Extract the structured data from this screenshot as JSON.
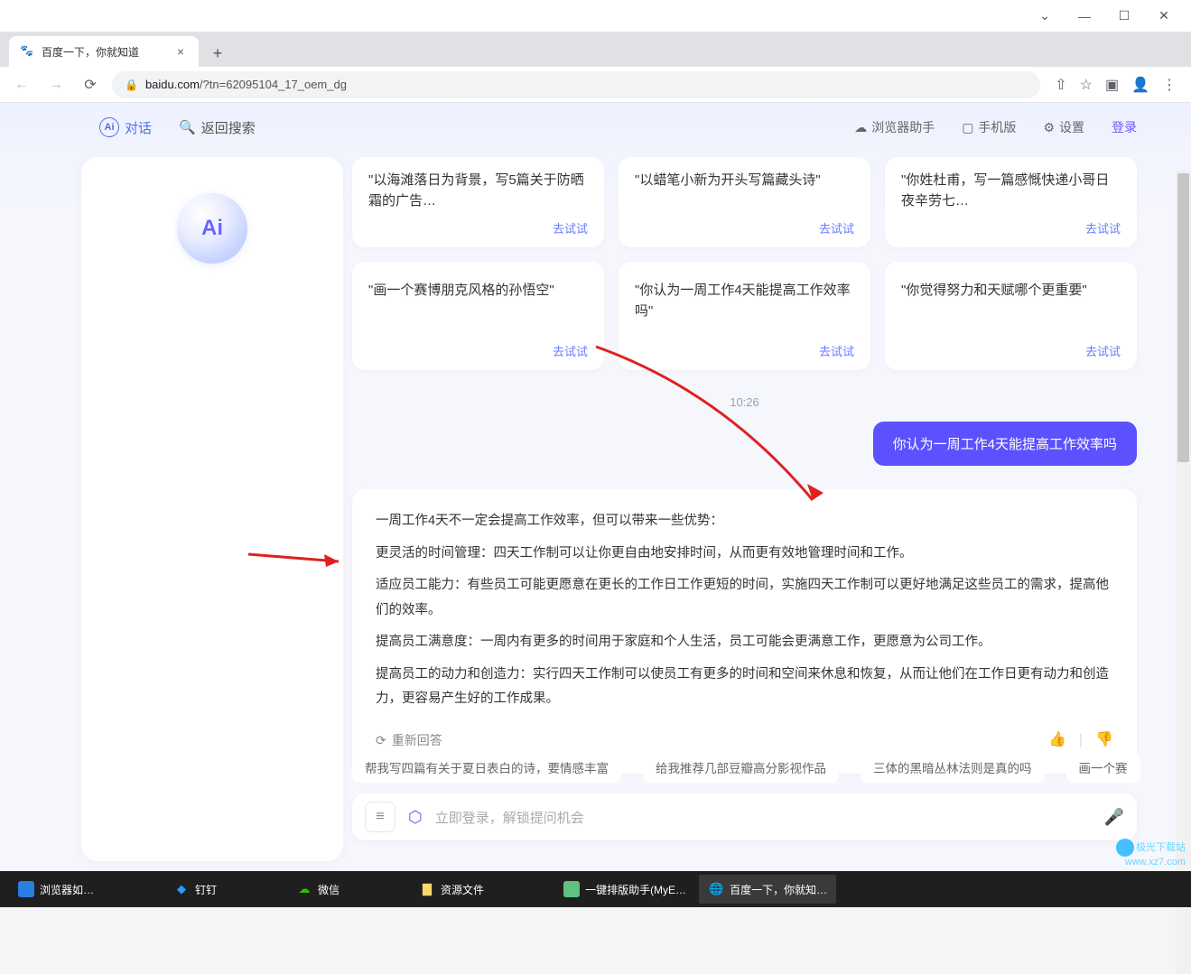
{
  "browser": {
    "tab_title": "百度一下，你就知道",
    "url_display": "baidu.com/?tn=62095104_17_oem_dg",
    "url_domain": "baidu.com",
    "url_path": "/?tn=62095104_17_oem_dg"
  },
  "topnav": {
    "dialog": "对话",
    "back_search": "返回搜索",
    "browser_helper": "浏览器助手",
    "mobile": "手机版",
    "settings": "设置",
    "login": "登录"
  },
  "sidebar": {
    "logo_text": "Ai"
  },
  "cards_row1": [
    {
      "text": "\"以海滩落日为背景，写5篇关于防晒霜的广告…",
      "action": "去试试"
    },
    {
      "text": "\"以蜡笔小新为开头写篇藏头诗\"",
      "action": "去试试"
    },
    {
      "text": "\"你姓杜甫，写一篇感慨快递小哥日夜辛劳七…",
      "action": "去试试"
    }
  ],
  "cards_row2": [
    {
      "text": "\"画一个赛博朋克风格的孙悟空\"",
      "action": "去试试"
    },
    {
      "text": "\"你认为一周工作4天能提高工作效率吗\"",
      "action": "去试试"
    },
    {
      "text": "\"你觉得努力和天赋哪个更重要\"",
      "action": "去试试"
    }
  ],
  "chat": {
    "time": "10:26",
    "user_message": "你认为一周工作4天能提高工作效率吗",
    "answer": {
      "p1": "一周工作4天不一定会提高工作效率，但可以带来一些优势：",
      "p2": "更灵活的时间管理：四天工作制可以让你更自由地安排时间，从而更有效地管理时间和工作。",
      "p3": "适应员工能力：有些员工可能更愿意在更长的工作日工作更短的时间，实施四天工作制可以更好地满足这些员工的需求，提高他们的效率。",
      "p4": "提高员工满意度：一周内有更多的时间用于家庭和个人生活，员工可能会更满意工作，更愿意为公司工作。",
      "p5": "提高员工的动力和创造力：实行四天工作制可以使员工有更多的时间和空间来休息和恢复，从而让他们在工作日更有动力和创造力，更容易产生好的工作成果。"
    },
    "regenerate": "重新回答"
  },
  "suggestions": [
    "帮我写四篇有关于夏日表白的诗，要情感丰富",
    "给我推荐几部豆瓣高分影视作品",
    "三体的黑暗丛林法则是真的吗",
    "画一个赛"
  ],
  "input": {
    "placeholder": "立即登录，解锁提问机会"
  },
  "taskbar": {
    "items": [
      {
        "label": "浏览器如…"
      },
      {
        "label": "钉钉"
      },
      {
        "label": "微信"
      },
      {
        "label": "资源文件"
      },
      {
        "label": "一键排版助手(MyE…"
      },
      {
        "label": "百度一下，你就知…"
      }
    ]
  },
  "watermark": {
    "line1": "极光下载站",
    "line2": "www.xz7.com"
  }
}
